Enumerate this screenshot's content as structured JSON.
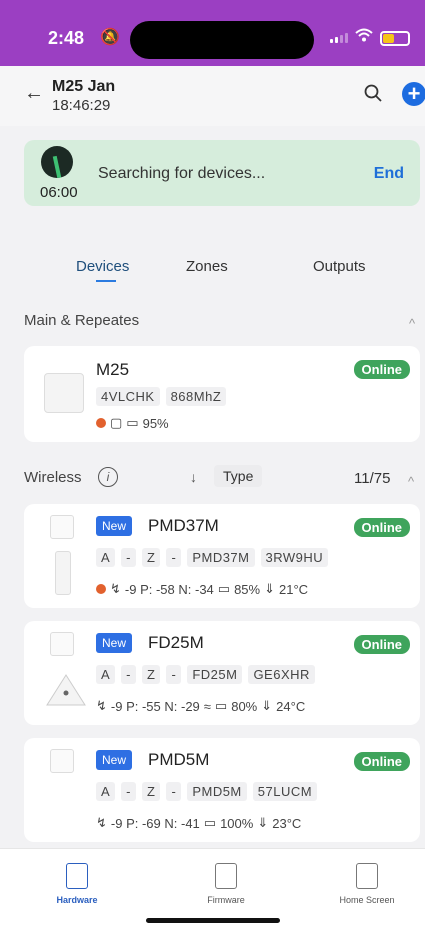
{
  "status_bar": {
    "time": "2:48",
    "battery_level": 0.45,
    "battery_color": "#f5c518",
    "bg_color": "#9b3fc2"
  },
  "header": {
    "title": "M25 Jan",
    "subtitle": "18:46:29",
    "icons": [
      "back-arrow-icon",
      "search-icon",
      "add-icon"
    ]
  },
  "banner": {
    "timer": "06:00",
    "message": "Searching for devices...",
    "end_label": "End"
  },
  "tabs": [
    {
      "label": "Devices",
      "active": true
    },
    {
      "label": "Zones",
      "active": false
    },
    {
      "label": "Outputs",
      "active": false
    }
  ],
  "main_section": {
    "title": "Main & Repeates"
  },
  "main_device": {
    "name": "M25",
    "chips": [
      "4VLCHK",
      "868MhZ"
    ],
    "battery": "95%",
    "status": "Online"
  },
  "wireless": {
    "title": "Wireless",
    "sort_label": "Type",
    "count": "11/75"
  },
  "devices": [
    {
      "badge": "New",
      "name": "PMD37M",
      "chips": [
        "A",
        "-",
        "Z",
        "-",
        "PMD37M",
        "3RW9HU"
      ],
      "stats": "-9  P: -58  N: -34",
      "battery": "85%",
      "temp": "21°C",
      "status": "Online"
    },
    {
      "badge": "New",
      "name": "FD25M",
      "chips": [
        "A",
        "-",
        "Z",
        "-",
        "FD25M",
        "GE6XHR"
      ],
      "stats": "-9  P: -55  N: -29",
      "battery": "80%",
      "temp": "24°C",
      "status": "Online"
    },
    {
      "badge": "New",
      "name": "PMD5M",
      "chips": [
        "A",
        "-",
        "Z",
        "-",
        "PMD5M",
        "57LUCM"
      ],
      "stats": "-9  P: -69  N: -41",
      "battery": "100%",
      "temp": "23°C",
      "status": "Online"
    }
  ],
  "bottom_nav": [
    {
      "label": "Hardware",
      "active": true
    },
    {
      "label": "Firmware",
      "active": false
    },
    {
      "label": "Home Screen",
      "active": false
    }
  ]
}
